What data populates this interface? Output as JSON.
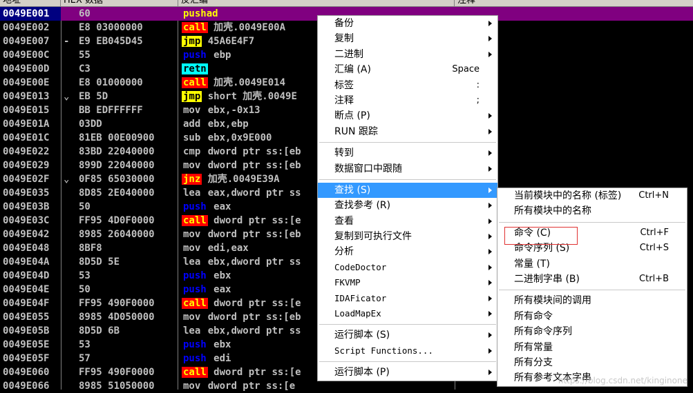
{
  "header": {
    "col_address": "地址",
    "col_hex": "HEX 数据",
    "col_disasm": "反汇编",
    "col_comment": "注释"
  },
  "rows": [
    {
      "addr": "0049E001",
      "mark": "",
      "hex": "60",
      "m": "pushad",
      "ops": "",
      "cls": "sel"
    },
    {
      "addr": "0049E002",
      "mark": "",
      "hex": "E8 03000000",
      "m": "call",
      "ops": "加壳.0049E00A",
      "cls": "call"
    },
    {
      "addr": "0049E007",
      "mark": "-",
      "hex": "E9 EB045D45",
      "m": "jmp",
      "ops": "45A6E4F7",
      "cls": "jmp"
    },
    {
      "addr": "0049E00C",
      "mark": "",
      "hex": "55",
      "m": "push",
      "ops": "ebp",
      "cls": "push"
    },
    {
      "addr": "0049E00D",
      "mark": "",
      "hex": "C3",
      "m": "retn",
      "ops": "",
      "cls": "retn"
    },
    {
      "addr": "0049E00E",
      "mark": "",
      "hex": "E8 01000000",
      "m": "call",
      "ops": "加壳.0049E014",
      "cls": "call"
    },
    {
      "addr": "0049E013",
      "mark": "⌄",
      "hex": "EB 5D",
      "m": "jmp",
      "ops": "short 加壳.0049E",
      "cls": "jmp"
    },
    {
      "addr": "0049E015",
      "mark": "",
      "hex": "BB EDFFFFFF",
      "m": "mov",
      "ops": "ebx,-0x13",
      "cls": "plain"
    },
    {
      "addr": "0049E01A",
      "mark": "",
      "hex": "03DD",
      "m": "add",
      "ops": "ebx,ebp",
      "cls": "plain"
    },
    {
      "addr": "0049E01C",
      "mark": "",
      "hex": "81EB 00E00900",
      "m": "sub",
      "ops": "ebx,0x9E000",
      "cls": "plain"
    },
    {
      "addr": "0049E022",
      "mark": "",
      "hex": "83BD 22040000",
      "m": "cmp",
      "ops": "dword ptr ss:[eb",
      "cls": "plain"
    },
    {
      "addr": "0049E029",
      "mark": "",
      "hex": "899D 22040000",
      "m": "mov",
      "ops": "dword ptr ss:[eb",
      "cls": "plain"
    },
    {
      "addr": "0049E02F",
      "mark": "⌄",
      "hex": "0F85 65030000",
      "m": "jnz",
      "ops": "加壳.0049E39A",
      "cls": "jnz"
    },
    {
      "addr": "0049E035",
      "mark": "",
      "hex": "8D85 2E040000",
      "m": "lea",
      "ops": "eax,dword ptr ss",
      "cls": "plain"
    },
    {
      "addr": "0049E03B",
      "mark": "",
      "hex": "50",
      "m": "push",
      "ops": "eax",
      "cls": "push"
    },
    {
      "addr": "0049E03C",
      "mark": "",
      "hex": "FF95 4D0F0000",
      "m": "call",
      "ops": "dword ptr ss:[e",
      "cls": "call"
    },
    {
      "addr": "0049E042",
      "mark": "",
      "hex": "8985 26040000",
      "m": "mov",
      "ops": "dword ptr ss:[eb",
      "cls": "plain"
    },
    {
      "addr": "0049E048",
      "mark": "",
      "hex": "8BF8",
      "m": "mov",
      "ops": "edi,eax",
      "cls": "plain"
    },
    {
      "addr": "0049E04A",
      "mark": "",
      "hex": "8D5D 5E",
      "m": "lea",
      "ops": "ebx,dword ptr ss",
      "cls": "plain"
    },
    {
      "addr": "0049E04D",
      "mark": "",
      "hex": "53",
      "m": "push",
      "ops": "ebx",
      "cls": "push"
    },
    {
      "addr": "0049E04E",
      "mark": "",
      "hex": "50",
      "m": "push",
      "ops": "eax",
      "cls": "push"
    },
    {
      "addr": "0049E04F",
      "mark": "",
      "hex": "FF95 490F0000",
      "m": "call",
      "ops": "dword ptr ss:[e",
      "cls": "call"
    },
    {
      "addr": "0049E055",
      "mark": "",
      "hex": "8985 4D050000",
      "m": "mov",
      "ops": "dword ptr ss:[eb",
      "cls": "plain"
    },
    {
      "addr": "0049E05B",
      "mark": "",
      "hex": "8D5D 6B",
      "m": "lea",
      "ops": "ebx,dword ptr ss",
      "cls": "plain"
    },
    {
      "addr": "0049E05E",
      "mark": "",
      "hex": "53",
      "m": "push",
      "ops": "ebx",
      "cls": "push"
    },
    {
      "addr": "0049E05F",
      "mark": "",
      "hex": "57",
      "m": "push",
      "ops": "edi",
      "cls": "push"
    },
    {
      "addr": "0049E060",
      "mark": "",
      "hex": "FF95 490F0000",
      "m": "call",
      "ops": "dword ptr ss:[e",
      "cls": "call"
    },
    {
      "addr": "0049E066",
      "mark": "",
      "hex": "8985 51050000",
      "m": "mov",
      "ops": "dword ptr ss:[e",
      "cls": "plain"
    }
  ],
  "context_menu": {
    "items": [
      {
        "label": "备份",
        "submenu": true
      },
      {
        "label": "复制",
        "submenu": true
      },
      {
        "label": "二进制",
        "submenu": true
      },
      {
        "label": "汇编 (A)",
        "shortcut": "Space"
      },
      {
        "label": "标签",
        "shortcut": ":"
      },
      {
        "label": "注释",
        "shortcut": ";"
      },
      {
        "label": "断点 (P)",
        "submenu": true
      },
      {
        "label": "RUN 跟踪",
        "submenu": true
      },
      {
        "sep": true
      },
      {
        "label": "转到",
        "submenu": true
      },
      {
        "label": "数据窗口中跟随",
        "submenu": true
      },
      {
        "sep": true
      },
      {
        "label": "查找 (S)",
        "submenu": true,
        "highlight": true
      },
      {
        "label": "查找参考 (R)",
        "submenu": true
      },
      {
        "label": "查看",
        "submenu": true
      },
      {
        "label": "复制到可执行文件",
        "submenu": true
      },
      {
        "label": "分析",
        "submenu": true
      },
      {
        "label": "CodeDoctor",
        "submenu": true,
        "mono": true
      },
      {
        "label": "FKVMP",
        "submenu": true,
        "mono": true
      },
      {
        "label": "IDAFicator",
        "submenu": true,
        "mono": true
      },
      {
        "label": "LoadMapEx",
        "submenu": true,
        "mono": true
      },
      {
        "sep": true
      },
      {
        "label": "运行脚本 (S)",
        "submenu": true
      },
      {
        "label": "Script Functions...",
        "submenu": true,
        "mono": true
      },
      {
        "sep": true
      },
      {
        "label": "运行脚本 (P)",
        "submenu": true
      }
    ]
  },
  "find_submenu": {
    "items": [
      {
        "label": "当前模块中的名称 (标签)",
        "shortcut": "Ctrl+N"
      },
      {
        "label": "所有模块中的名称"
      },
      {
        "sep": true
      },
      {
        "label": "命令 (C)",
        "shortcut": "Ctrl+F",
        "boxed": true
      },
      {
        "label": "命令序列 (S)",
        "shortcut": "Ctrl+S"
      },
      {
        "label": "常量 (T)"
      },
      {
        "label": "二进制字串 (B)",
        "shortcut": "Ctrl+B"
      },
      {
        "sep": true
      },
      {
        "label": "所有模块间的调用"
      },
      {
        "label": "所有命令"
      },
      {
        "label": "所有命令序列"
      },
      {
        "label": "所有常量"
      },
      {
        "label": "所有分支"
      },
      {
        "label": "所有参考文本字串"
      }
    ]
  },
  "watermark": "https://blog.csdn.net/kinginone",
  "colors": {
    "background": "#000000",
    "selection": "#800080",
    "menu_highlight": "#3399ff",
    "box": "#e03030"
  }
}
